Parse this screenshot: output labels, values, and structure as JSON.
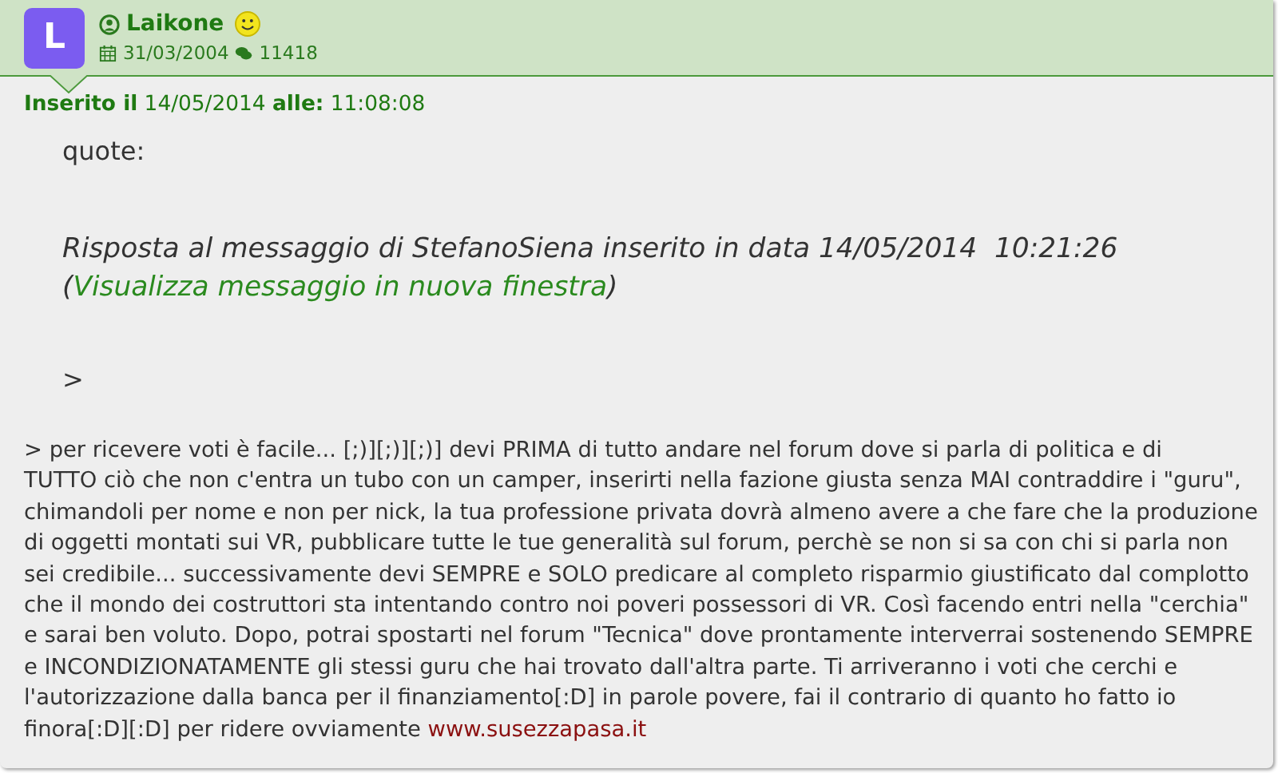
{
  "author": {
    "initial": "L",
    "name": "Laikone",
    "joined": "31/03/2004",
    "posts": "11418"
  },
  "posted": {
    "label": "Inserito il",
    "date": "14/05/2014",
    "time_label": "alle:",
    "time": "11:08:08"
  },
  "quote": {
    "label": "quote:",
    "reply_line": "Risposta al messaggio di StefanoSiena inserito in data 14/05/2014  10:21:26",
    "link_open": "(",
    "link": "Visualizza messaggio in nuova finestra",
    "link_close": ")",
    "marker": ">"
  },
  "body_lines": [
    "> per ricevere voti è facile... [;)][;)][;)] devi PRIMA di tutto andare nel forum dove si parla di politica e di",
    "TUTTO ciò che non c'entra un tubo con un camper, inserirti nella fazione giusta senza MAI contraddire i \"guru\",",
    "chimandoli per nome e non per nick, la tua professione privata dovrà almeno avere a che fare che la produzione",
    "di oggetti montati sui VR, pubblicare tutte le tue generalità sul forum, perchè se non si sa con chi si parla non",
    "sei credibile... successivamente devi SEMPRE e SOLO predicare al completo risparmio giustificato dal complotto",
    "che il mondo dei costruttori sta intentando contro noi poveri possessori di VR. Così facendo entri nella \"cerchia\"",
    "e sarai ben voluto. Dopo, potrai spostarti nel forum \"Tecnica\" dove prontamente interverrai sostenendo SEMPRE",
    "e INCONDIZIONATAMENTE gli stessi guru che hai trovato dall'altra parte. Ti arriveranno i voti che cerchi e",
    "l'autorizzazione dalla banca per il finanziamento[:D] in parole povere, fai il contrario di quanto ho fatto io",
    "finora[:D][:D] per ridere ovviamente "
  ],
  "body_link": "www.susezzapasa.it"
}
